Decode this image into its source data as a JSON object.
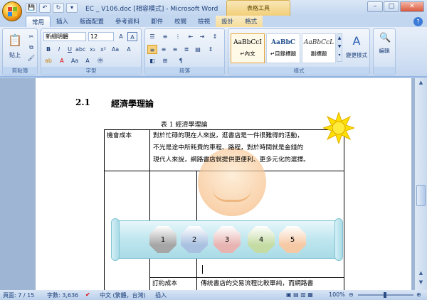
{
  "window": {
    "title": "EC _ V106.doc [相容模式] - Microsoft Word",
    "table_tools": "表格工具"
  },
  "qat": [
    "💾",
    "↶",
    "↻",
    "▾"
  ],
  "tabs": [
    "常用",
    "插入",
    "版面配置",
    "參考資料",
    "郵件",
    "校閱",
    "檢視",
    "設計",
    "格式"
  ],
  "ribbon": {
    "clipboard": {
      "paste": "貼上",
      "label": "剪貼簿"
    },
    "font": {
      "name": "新細明體",
      "size": "12",
      "label": "字型"
    },
    "paragraph": {
      "label": "段落"
    },
    "styles": {
      "items": [
        {
          "preview": "AaBbCcI",
          "name": "↵內文"
        },
        {
          "preview": "AaBbC",
          "name": "↵目錄標題"
        },
        {
          "preview": "AaBbCcL",
          "name": "副標題"
        }
      ],
      "change": "變更樣式",
      "label": "樣式"
    },
    "editing": {
      "label": "編輯"
    }
  },
  "document": {
    "section_num": "2.1",
    "section_title": "經濟學理論",
    "table_caption": "表 1  經濟學理論",
    "row1": {
      "label": "機會成本",
      "lines": [
        "對於忙碌的現在人來說，逛書店是一件很難得的活動，",
        "不光是途中所耗費的車程、路程，對於時間就是金錢的",
        "現代人來說，網路書店就提供更便利、更多元化的選擇。"
      ]
    },
    "row3": {
      "label": "訂約成本",
      "text": "傳統書店的交易流程比較單純，而網路書"
    },
    "shapes": [
      {
        "label": "1",
        "color": "#a6a6a6"
      },
      {
        "label": "2",
        "color": "#a9c0e0"
      },
      {
        "label": "3",
        "color": "#e7b4b2"
      },
      {
        "label": "4",
        "color": "#c4dca4"
      },
      {
        "label": "5",
        "color": "#f6c9a5"
      }
    ]
  },
  "status": {
    "page": "頁面: 7 / 15",
    "words": "字數: 3,636",
    "lang": "中文 (繁體，台灣)",
    "mode": "插入",
    "zoom": "100%"
  }
}
